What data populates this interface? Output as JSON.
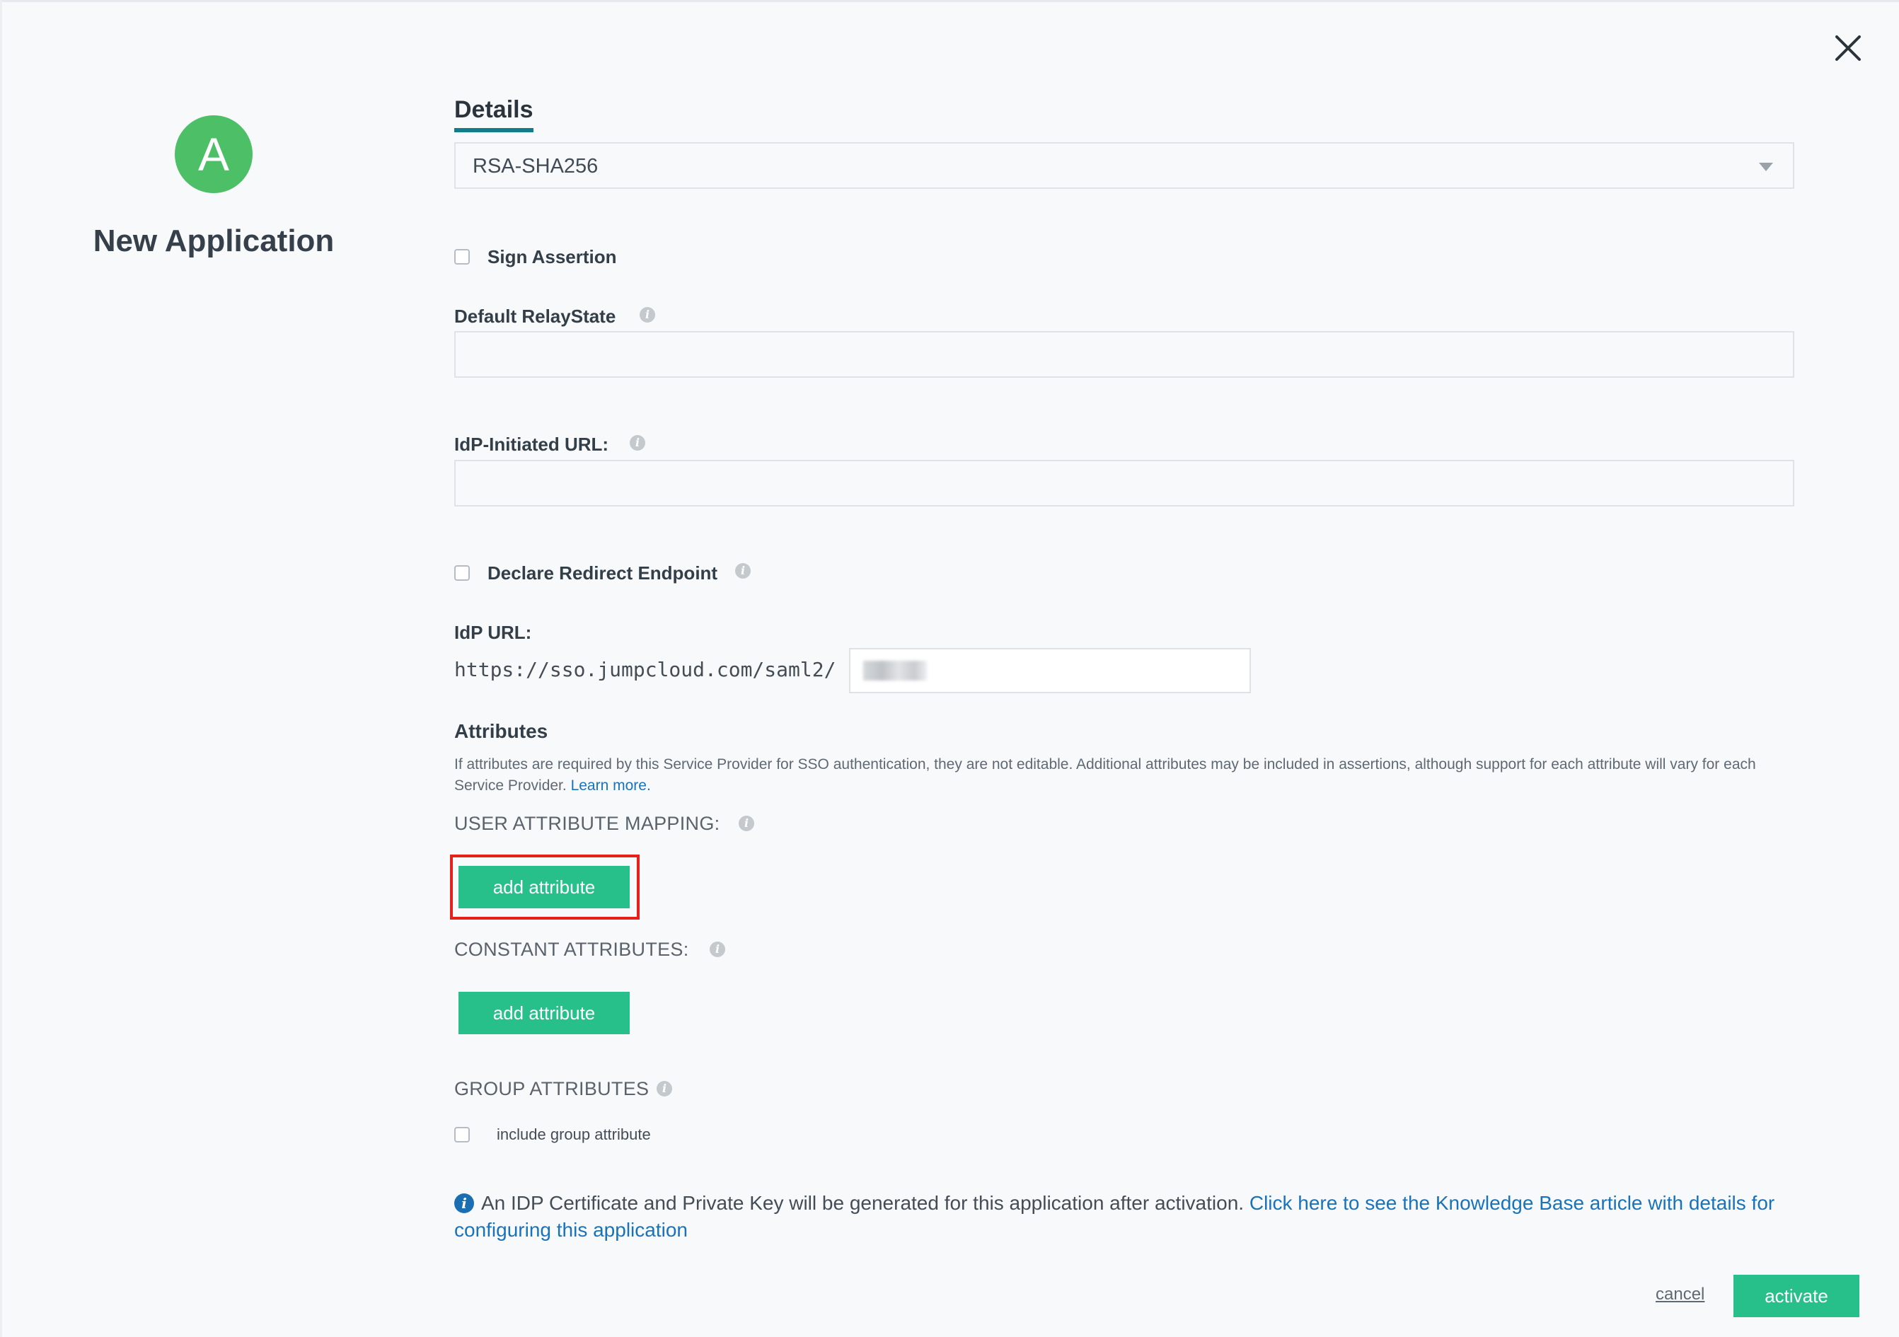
{
  "app": {
    "avatar_letter": "A",
    "title": "New Application"
  },
  "tabs": {
    "details_label": "Details"
  },
  "signature_algorithm": {
    "selected": "RSA-SHA256"
  },
  "sign_assertion": {
    "label": "Sign Assertion",
    "checked": false
  },
  "default_relay_state": {
    "label": "Default RelayState",
    "value": ""
  },
  "idp_initiated_url": {
    "label": "IdP-Initiated URL:",
    "value": ""
  },
  "declare_redirect_endpoint": {
    "label": "Declare Redirect Endpoint",
    "checked": false
  },
  "idp_url": {
    "label": "IdP URL:",
    "prefix": "https://sso.jumpcloud.com/saml2/",
    "value": ""
  },
  "attributes": {
    "title": "Attributes",
    "description": "If attributes are required by this Service Provider for SSO authentication, they are not editable. Additional attributes may be included in assertions, although support for each attribute will vary for each Service Provider.",
    "learn_more": "Learn more.",
    "user_mapping_label": "USER ATTRIBUTE MAPPING:",
    "user_add_button": "add attribute",
    "constant_label": "CONSTANT ATTRIBUTES:",
    "constant_add_button": "add attribute",
    "group_label": "GROUP ATTRIBUTES",
    "include_group_label": "include group attribute"
  },
  "notice": {
    "text": "An IDP Certificate and Private Key will be generated for this application after activation.",
    "link_text": "Click here to see the Knowledge Base article with details for configuring this application"
  },
  "footer": {
    "cancel_label": "cancel",
    "activate_label": "activate"
  },
  "colors": {
    "accent_green": "#27c08b",
    "avatar_green": "#4cbf67",
    "tab_underline": "#117c8a",
    "link_blue": "#1a73b9",
    "highlight_red": "#e6201b"
  }
}
